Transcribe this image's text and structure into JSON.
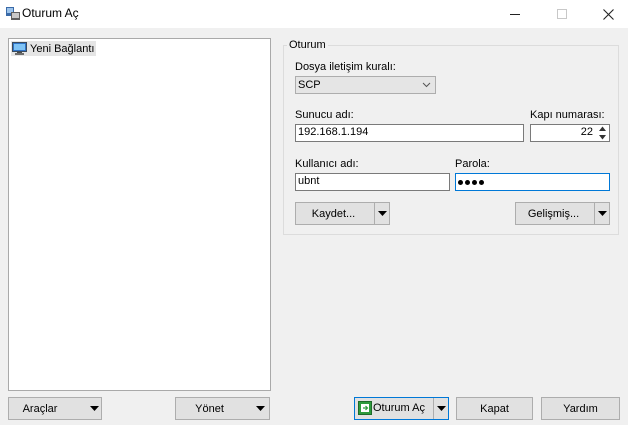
{
  "window": {
    "title": "Oturum Aç"
  },
  "sidebar": {
    "items": [
      {
        "label": "Yeni Bağlantı"
      }
    ]
  },
  "session": {
    "group_label": "Oturum",
    "protocol_label": "Dosya iletişim kuralı:",
    "protocol_value": "SCP",
    "host_label": "Sunucu adı:",
    "host_value": "192.168.1.194",
    "port_label": "Kapı numarası:",
    "port_value": "22",
    "user_label": "Kullanıcı adı:",
    "user_value": "ubnt",
    "password_label": "Parola:",
    "password_dot_count": 4,
    "save_label": "Kaydet...",
    "advanced_label": "Gelişmiş..."
  },
  "footer": {
    "tools_label": "Araçlar",
    "manage_label": "Yönet",
    "login_label": "Oturum Aç",
    "close_label": "Kapat",
    "help_label": "Yardım"
  },
  "colors": {
    "focus_border": "#0078d7",
    "login_button_border": "#0078d7",
    "login_icon": "#2e9b3d"
  },
  "icons": [
    "app-icon",
    "computer-icon",
    "chevron-down-icon",
    "dropdown-arrow-icon",
    "login-icon",
    "minimize-icon",
    "maximize-icon",
    "close-icon"
  ]
}
